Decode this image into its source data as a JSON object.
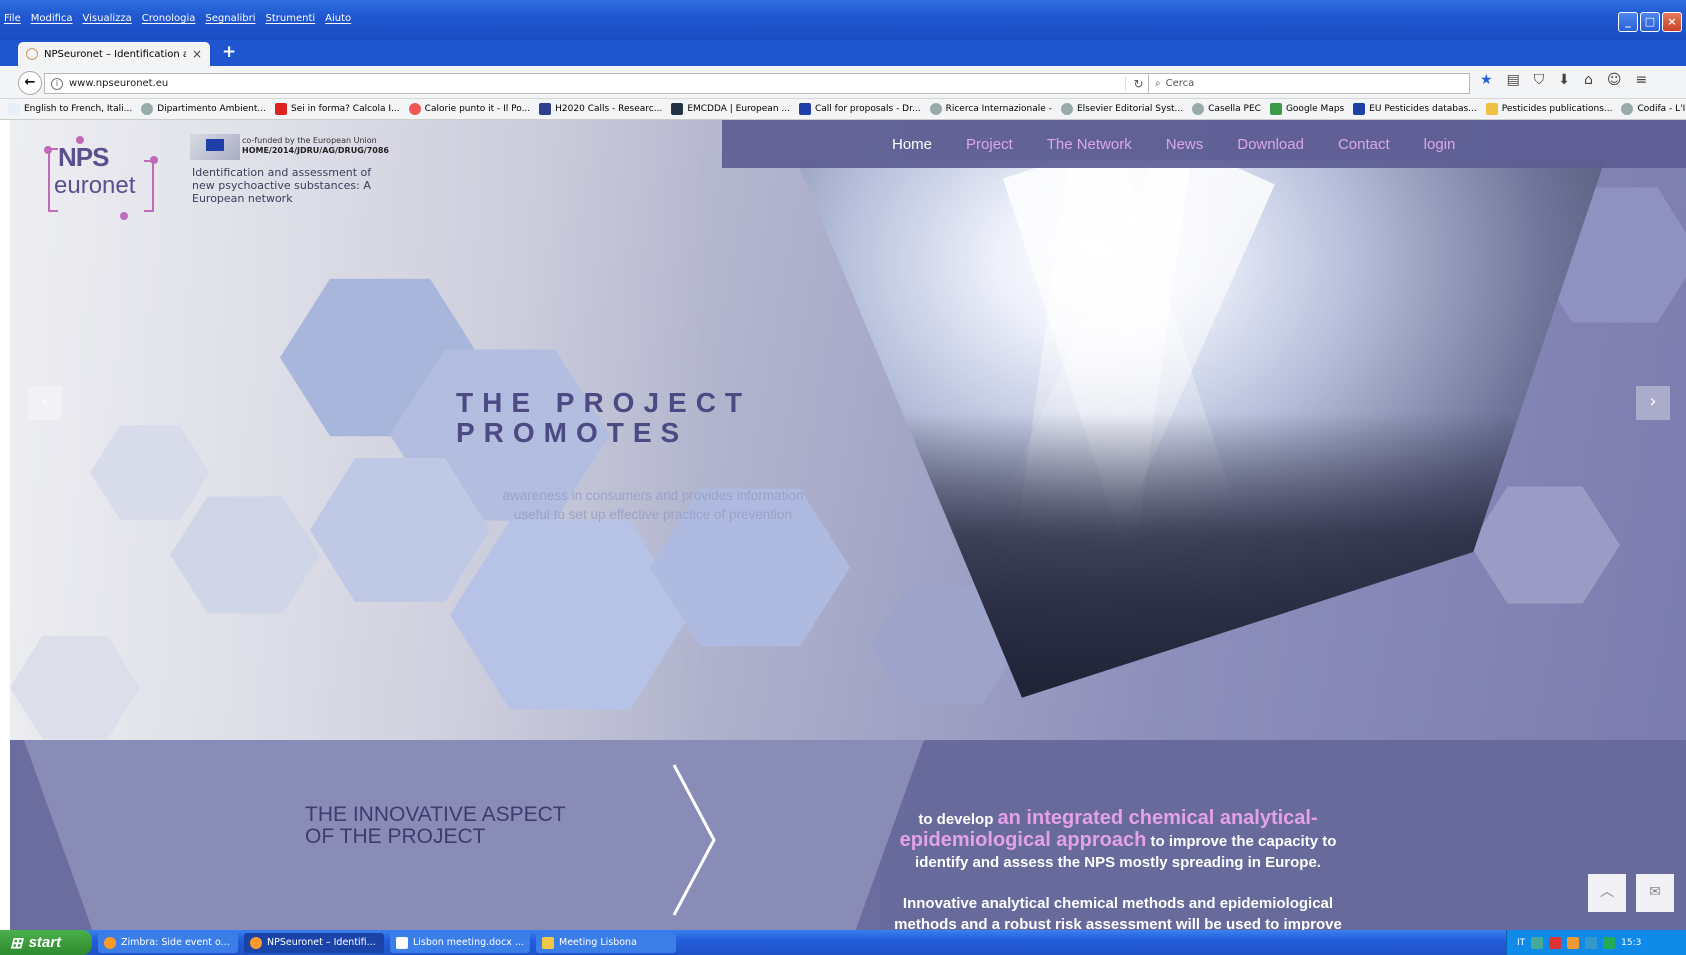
{
  "menu": [
    "File",
    "Modifica",
    "Visualizza",
    "Cronologia",
    "Segnalibri",
    "Strumenti",
    "Aiuto"
  ],
  "tab": {
    "title": "NPSeuronet – Identification a..."
  },
  "address": {
    "url": "www.npseuronet.eu"
  },
  "search": {
    "placeholder": "Cerca"
  },
  "bookmarks": [
    "English to French, Itali...",
    "Dipartimento Ambient...",
    "Sei in forma? Calcola I...",
    "Calorie punto it - Il Po...",
    "H2020 Calls - Researc...",
    "EMCDDA | European ...",
    "Call for proposals - Dr...",
    "Ricerca Internazionale -",
    "Elsevier Editorial Syst...",
    "Casella PEC",
    "Google Maps",
    "EU Pesticides databas...",
    "Pesticides publications...",
    "Codifa - L'Informatore..."
  ],
  "site": {
    "logo_line1": "NPS",
    "logo_line2": "euronet",
    "eu_cofunded": "co-funded by the European Union",
    "eu_code": "HOME/2014/JDRU/AG/DRUG/7086",
    "tagline": "Identification and assessment of new psychoactive substances: A European network",
    "nav": [
      "Home",
      "Project",
      "The Network",
      "News",
      "Download",
      "Contact",
      "login"
    ]
  },
  "slide": {
    "title_line1": "THE PROJECT",
    "title_line2": "PROMOTES",
    "text": "awareness in consumers and provides information useful to set up effective practice of prevention"
  },
  "innovation": {
    "heading_line1": "THE INNOVATIVE ASPECT",
    "heading_line2": "OF THE PROJECT",
    "pre": "to develop",
    "highlight": "an integrated chemical analytical-epidemiological approach",
    "post": "to improve the capacity to identify and assess the NPS mostly spreading in Europe.",
    "para2": "Innovative analytical chemical methods and epidemiological methods and a robust risk assessment will be used to improve"
  },
  "taskbar": {
    "start": "start",
    "tasks": [
      "Zimbra: Side event o...",
      "NPSeuronet – Identifi...",
      "Lisbon meeting.docx ...",
      "Meeting Lisbona"
    ],
    "lang": "IT",
    "clock": "15:3"
  },
  "colors": {
    "accent_purple": "#5c5c92",
    "nav_link": "#d9a8e6",
    "highlight": "#e3a2e8"
  }
}
